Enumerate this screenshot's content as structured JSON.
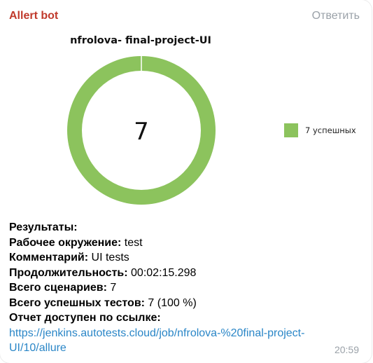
{
  "message": {
    "sender": "Allert bot",
    "reply_label": "Ответить",
    "time": "20:59"
  },
  "chart_data": {
    "type": "pie",
    "title": "nfrolova- final-project-UI",
    "center_label": "7",
    "slices": [
      {
        "name": "7 успешных",
        "value": 7,
        "color": "#8cc35d"
      }
    ],
    "legend_position": "right"
  },
  "report": {
    "heading": "Результаты:",
    "rows": [
      {
        "key": "Рабочее окружение:",
        "value": " test"
      },
      {
        "key": "Комментарий:",
        "value": " UI tests"
      },
      {
        "key": "Продолжительность:",
        "value": " 00:02:15.298"
      },
      {
        "key": "Всего сценариев:",
        "value": " 7"
      },
      {
        "key": "Всего успешных тестов:",
        "value": " 7 (100 %)"
      }
    ],
    "link_label": "Отчет доступен по ссылке:",
    "link_text": "https://jenkins.autotests.cloud/job/nfrolova-%20final-project-UI/10/allure"
  },
  "colors": {
    "sender": "#c0392b",
    "link": "#2a86c7",
    "success": "#8cc35d"
  }
}
